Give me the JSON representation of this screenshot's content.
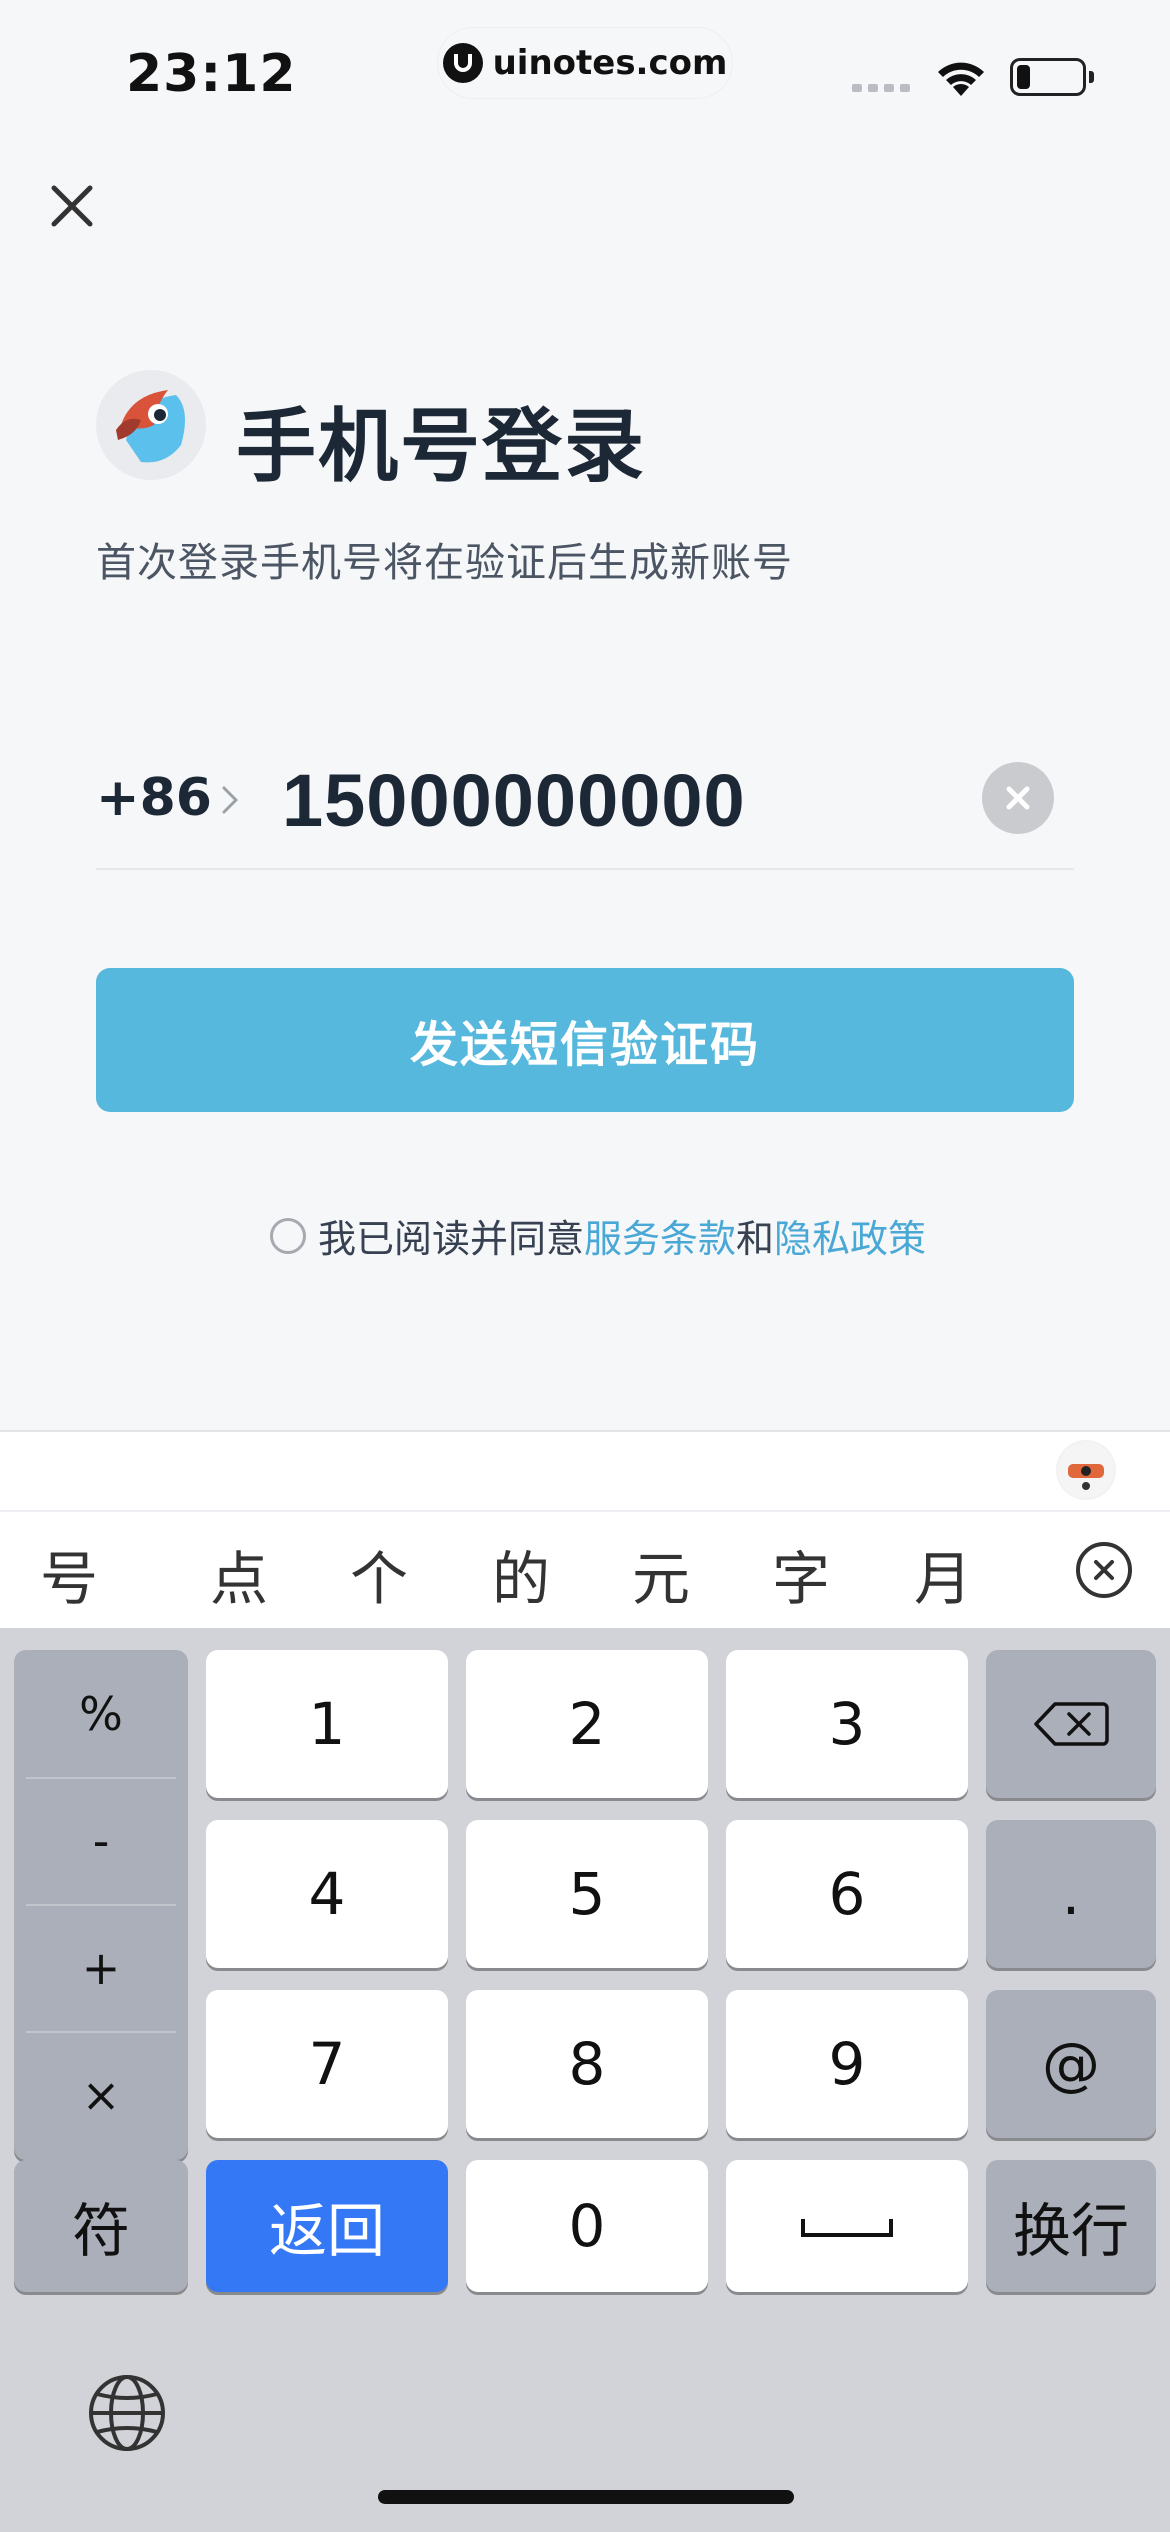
{
  "status_bar": {
    "time": "23:12",
    "url": "uinotes.com",
    "battery_level": 0.2
  },
  "header": {
    "close_icon": "close-icon"
  },
  "title": {
    "heading": "手机号登录",
    "subtitle": "首次登录手机号将在验证后生成新账号",
    "logo_icon": "bird-logo-icon"
  },
  "phone": {
    "country_code": "+86",
    "value": "15000000000",
    "clear_icon": "clear-icon"
  },
  "send_button": {
    "label": "发送短信验证码",
    "color": "#56b8dd"
  },
  "agreement": {
    "prefix": "我已阅读并同意",
    "terms": "服务条款",
    "conjunction": "和",
    "privacy": "隐私政策",
    "link_color": "#4aa8d6"
  },
  "keyboard": {
    "candidates": [
      "号",
      "点",
      "个",
      "的",
      "元",
      "字",
      "月"
    ],
    "symbols": [
      "%",
      "-",
      "+",
      "×"
    ],
    "digits": [
      "1",
      "2",
      "3",
      "4",
      "5",
      "6",
      "7",
      "8",
      "9",
      "0"
    ],
    "dot": ".",
    "at": "@",
    "fu": "符",
    "back": "返回",
    "enter": "换行",
    "accent_color": "#3478f6"
  }
}
